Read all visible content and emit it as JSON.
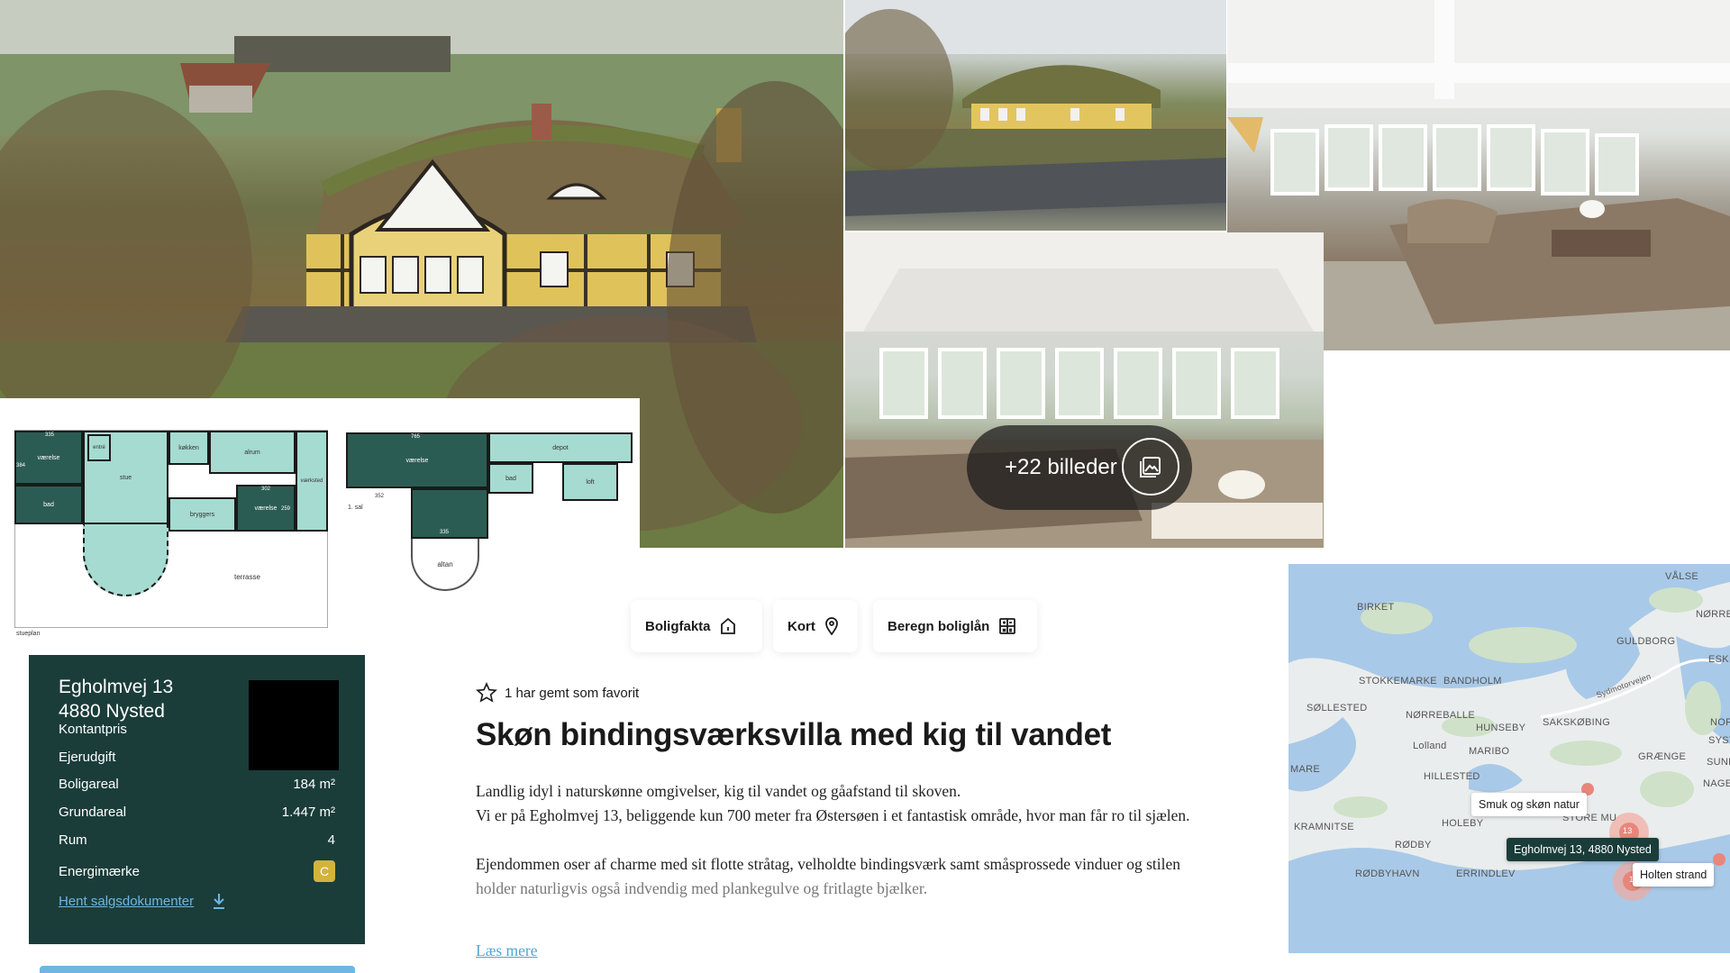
{
  "gallery": {
    "more_label": "+22 billeder",
    "icon": "gallery-icon"
  },
  "floorplan": {
    "rooms": {
      "vaerelse1": "værelse",
      "entre": "entré",
      "koekken": "køkken",
      "alrum": "alrum",
      "vaerksted": "værksted",
      "bad": "bad",
      "stue": "stue",
      "bryggers": "bryggers",
      "vaerelse2": "værelse",
      "vaerelse3": "værelse",
      "depot": "depot",
      "bad2": "bad",
      "loft": "loft",
      "altan": "altan",
      "terrasse": "terrasse"
    },
    "dimensions": {
      "d335": "335",
      "d384": "384",
      "d302": "302",
      "d259": "259",
      "d765": "765",
      "d352": "352",
      "d335b": "335"
    },
    "floor_label_1": "stueplan",
    "floor_label_2": "1. sal"
  },
  "tabs": [
    {
      "label": "Boligfakta",
      "icon": "house-icon"
    },
    {
      "label": "Kort",
      "icon": "map-pin-icon"
    },
    {
      "label": "Beregn boliglån",
      "icon": "calculator-icon"
    }
  ],
  "facts": {
    "street": "Egholmvej 13",
    "city": "4880 Nysted",
    "rows": [
      {
        "label": "Kontantpris",
        "value": ""
      },
      {
        "label": "Ejerudgift",
        "value": ""
      },
      {
        "label": "Boligareal",
        "value": "184 m²"
      },
      {
        "label": "Grundareal",
        "value": "1.447 m²"
      },
      {
        "label": "Rum",
        "value": "4"
      },
      {
        "label": "Energimærke",
        "value": "C"
      }
    ],
    "download_label": "Hent salgsdokumenter",
    "energy_color": "#d3b33c",
    "card_color": "#1a3d3a"
  },
  "listing": {
    "favorite_text": "1 har gemt som favorit",
    "title": "Skøn bindingsværksvilla med kig til vandet",
    "para1_line1": "Landlig idyl i naturskønne omgivelser, kig til vandet og gåafstand til skoven.",
    "para1_line2": "Vi er på Egholmvej 13, beliggende kun 700 meter fra Østersøen i et fantastisk område, hvor man får ro til sjælen.",
    "para2_line1": "Ejendommen oser af charme med sit flotte stråtag, velholdte bindingsværk samt småsprossede vinduer og stilen",
    "para2_line2": "holder naturligvis også indvendig med plankegulve og fritlagte bjælker.",
    "read_more": "Læs mere"
  },
  "map": {
    "places": {
      "valse": "VÅLSE",
      "birket": "BIRKET",
      "norre": "NØRRE",
      "guldborg": "GULDBORG",
      "eski": "ESKI",
      "stokkemarke": "STOKKEMARKE",
      "bandholm": "BANDHOLM",
      "sydmotorvejen": "Sydmotorvejen",
      "sollested": "SØLLESTED",
      "norreballe": "NØRREBALLE",
      "hunseby": "HUNSEBY",
      "sakskobing": "SAKSKØBING",
      "nor": "NOR",
      "syst": "SYST",
      "lolland": "Lolland",
      "maribo": "MARIBO",
      "graenge": "GRÆNGE",
      "sundb": "SUNDB",
      "mare": "MARE",
      "hillested": "HILLESTED",
      "nagels": "NAGELS",
      "kramnitse": "KRAMNITSE",
      "holeby": "HOLEBY",
      "store_mu": "STORE MU",
      "rodby": "RØDBY",
      "rodbyhavn": "RØDBYHAVN",
      "errindlev": "ERRINDLEV"
    },
    "tooltip_nature": "Smuk og skøn natur",
    "tooltip_address": "Egholmvej 13, 4880 Nysted",
    "tooltip_beach": "Holten strand",
    "cluster_count": "13",
    "cluster_count_2": "1"
  }
}
